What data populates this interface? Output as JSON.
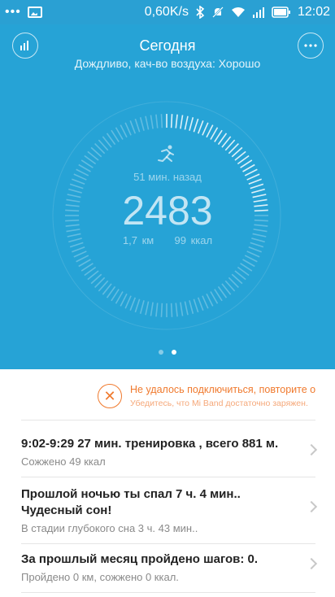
{
  "status_bar": {
    "dots": "•••",
    "speed": "0,60K/s",
    "time": "12:02",
    "icons": [
      "notification-dots-icon",
      "image-icon",
      "bluetooth-icon",
      "mute-icon",
      "wifi-icon",
      "signal-icon",
      "battery-icon"
    ]
  },
  "header": {
    "title": "Сегодня",
    "subtitle": "Дождливо, кач-во воздуха: Хорошо",
    "left_icon": "stats-icon",
    "right_icon": "more-icon"
  },
  "activity": {
    "ago": "51 мин. назад",
    "steps": "2483",
    "distance": "1,7 км",
    "calories": "99 ккал",
    "progress": 0.25
  },
  "pager": {
    "pages": 2,
    "active": 2
  },
  "alert": {
    "title": "Не удалось подключиться, повторите о",
    "subtitle": "Убедитесь, что Mi Band достаточно заряжен."
  },
  "feed": [
    {
      "title": "9:02-9:29  27 мин. тренировка , всего 881 м.",
      "subtitle": "Сожжено 49 ккал"
    },
    {
      "title": "Прошлой ночью ты спал 7 ч. 4 мин.. Чудесный сон!",
      "subtitle": "В стадии глубокого сна 3 ч. 43 мин.."
    },
    {
      "title": "За прошлый месяц пройдено шагов: 0.",
      "subtitle": "Пройдено 0 км, сожжено 0 ккал."
    }
  ],
  "colors": {
    "hero_bg": "#26a3d6",
    "alert": "#f07a2e",
    "text": "#222222",
    "muted": "#8a8a8a"
  }
}
